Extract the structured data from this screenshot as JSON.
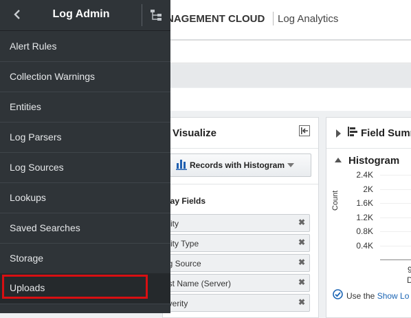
{
  "header": {
    "brand_title": "NAGEMENT CLOUD",
    "brand_subtitle": "Log Analytics"
  },
  "sidebar": {
    "title": "Log Admin",
    "back_icon": "chevron-left-icon",
    "tree_icon": "hierarchy-icon",
    "items": [
      {
        "label": "Alert Rules"
      },
      {
        "label": "Collection Warnings"
      },
      {
        "label": "Entities"
      },
      {
        "label": "Log Parsers"
      },
      {
        "label": "Log Sources"
      },
      {
        "label": "Lookups"
      },
      {
        "label": "Saved Searches"
      },
      {
        "label": "Storage"
      },
      {
        "label": "Uploads",
        "selected": true
      }
    ],
    "selection_color": "#d80f12"
  },
  "visualize": {
    "title": "Visualize",
    "visualization_select": "Records with Histogram",
    "display_fields_title": "play Fields",
    "fields": [
      {
        "label": "ntity"
      },
      {
        "label": "ntity Type"
      },
      {
        "label": "og Source"
      },
      {
        "label": "ost Name (Server)"
      },
      {
        "label": "everity"
      }
    ],
    "remove_glyph": "✖"
  },
  "field_summary": {
    "title": "Field Summ",
    "histogram": {
      "title": "Histogram",
      "ylabel": "Count",
      "y_ticks": [
        "2.4K",
        "2K",
        "1.6K",
        "1.2K",
        "0.8K",
        "0.4K"
      ],
      "x_tick_partial": "9",
      "x_tick_partial_2": "D"
    },
    "hint": {
      "prefix": "Use the ",
      "link": "Show Lo"
    }
  },
  "colors": {
    "sidebar_bg": "#2f3438",
    "accent_link": "#1a64b4"
  }
}
